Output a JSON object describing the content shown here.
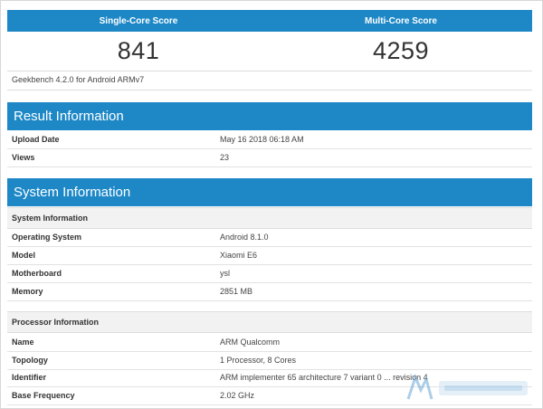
{
  "scores": {
    "single_label": "Single-Core Score",
    "multi_label": "Multi-Core Score",
    "single_value": "841",
    "multi_value": "4259",
    "version": "Geekbench 4.2.0 for Android ARMv7"
  },
  "result": {
    "title": "Result Information",
    "rows": [
      {
        "key": "Upload Date",
        "value": "May 16 2018 06:18 AM"
      },
      {
        "key": "Views",
        "value": "23"
      }
    ]
  },
  "system": {
    "title": "System Information",
    "sub1": "System Information",
    "rows": [
      {
        "key": "Operating System",
        "value": "Android 8.1.0"
      },
      {
        "key": "Model",
        "value": "Xiaomi E6"
      },
      {
        "key": "Motherboard",
        "value": "ysl"
      },
      {
        "key": "Memory",
        "value": "2851 MB"
      }
    ],
    "sub2": "Processor Information",
    "proc_rows": [
      {
        "key": "Name",
        "value": "ARM Qualcomm"
      },
      {
        "key": "Topology",
        "value": "1 Processor, 8 Cores"
      },
      {
        "key": "Identifier",
        "value": "ARM implementer 65 architecture 7 variant 0 ... revision 4"
      },
      {
        "key": "Base Frequency",
        "value": "2.02 GHz"
      }
    ]
  },
  "colors": {
    "accent": "#1e88c7"
  },
  "watermark_icon": "watermark-logo-icon"
}
